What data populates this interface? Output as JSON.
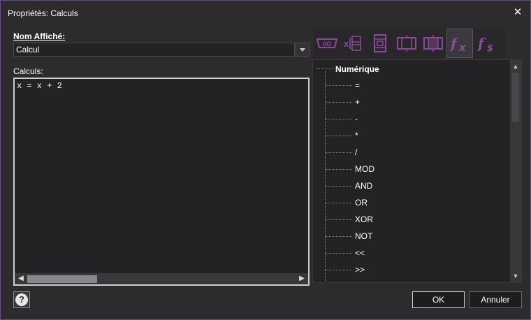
{
  "window": {
    "title": "Propriétés: Calculs",
    "close_glyph": "✕"
  },
  "fields": {
    "name_label": "Nom Affiché:",
    "name_value": "Calcul",
    "calc_label": "Calculs:",
    "calc_code": "x = x + 2"
  },
  "toolbar": {
    "icons": [
      "io-icon",
      "x-block-icon",
      "stacked-block-icon",
      "horizontal-block-icon",
      "cross-block-icon",
      "function-fx-icon",
      "function-currency-icon"
    ],
    "active_index": 5,
    "accent": "#8b4a9c"
  },
  "tree": {
    "root": "Numérique",
    "items": [
      "=",
      "+",
      "-",
      "*",
      "/",
      "MOD",
      "AND",
      "OR",
      "XOR",
      "NOT",
      "<<",
      ">>"
    ]
  },
  "buttons": {
    "ok": "OK",
    "cancel": "Annuler",
    "help": "?"
  },
  "colors": {
    "border": "#6b4a86",
    "background": "#2e2b2f",
    "field": "#252226"
  }
}
